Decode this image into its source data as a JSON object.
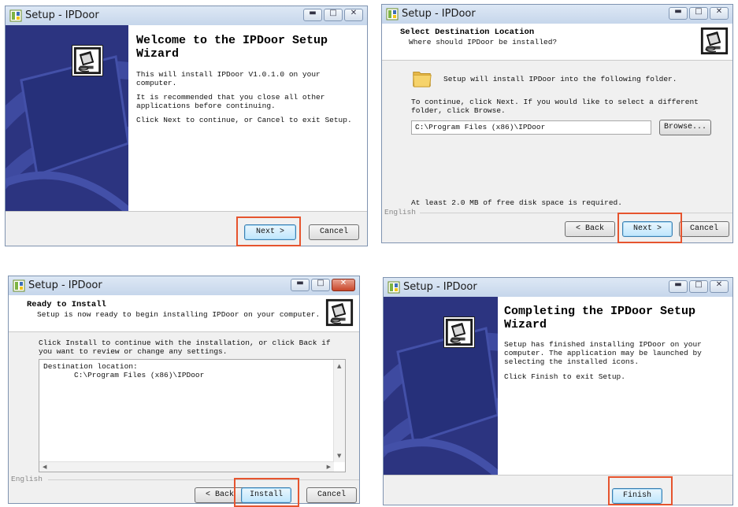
{
  "window_title": "Setup - IPDoor",
  "welcome": {
    "title": "Welcome to the IPDoor Setup Wizard",
    "para1": "This will install IPDoor V1.0.1.0 on your computer.",
    "para2": "It is recommended that you close all other applications before continuing.",
    "para3": "Click Next to continue, or Cancel to exit Setup.",
    "next_label": "Next >",
    "cancel_label": "Cancel"
  },
  "destination": {
    "header_title": "Select Destination Location",
    "header_subtitle": "Where should IPDoor be installed?",
    "intro": "Setup will install IPDoor into the following folder.",
    "instructions": "To continue, click Next. If you would like to select a different folder, click Browse.",
    "path_value": "C:\\Program Files (x86)\\IPDoor",
    "browse_label": "Browse...",
    "space_note": "At least 2.0 MB of free disk space is required.",
    "language": "English",
    "back_label": "< Back",
    "next_label": "Next >",
    "cancel_label": "Cancel"
  },
  "ready": {
    "header_title": "Ready to Install",
    "header_subtitle": "Setup is now ready to begin installing IPDoor on your computer.",
    "instructions": "Click Install to continue with the installation, or click Back if you want to review or change any settings.",
    "memo_label": "Destination location:",
    "memo_value": "C:\\Program Files (x86)\\IPDoor",
    "language": "English",
    "back_label": "< Back",
    "install_label": "Install",
    "cancel_label": "Cancel"
  },
  "finish": {
    "title": "Completing the IPDoor Setup Wizard",
    "para1": "Setup has finished installing IPDoor on your computer. The application may be launched by selecting the installed icons.",
    "para2": "Click Finish to exit Setup.",
    "finish_label": "Finish"
  },
  "colors": {
    "highlight": "#e6542e",
    "sidebar": "#2c3480",
    "default_button": "#bee6fd"
  }
}
